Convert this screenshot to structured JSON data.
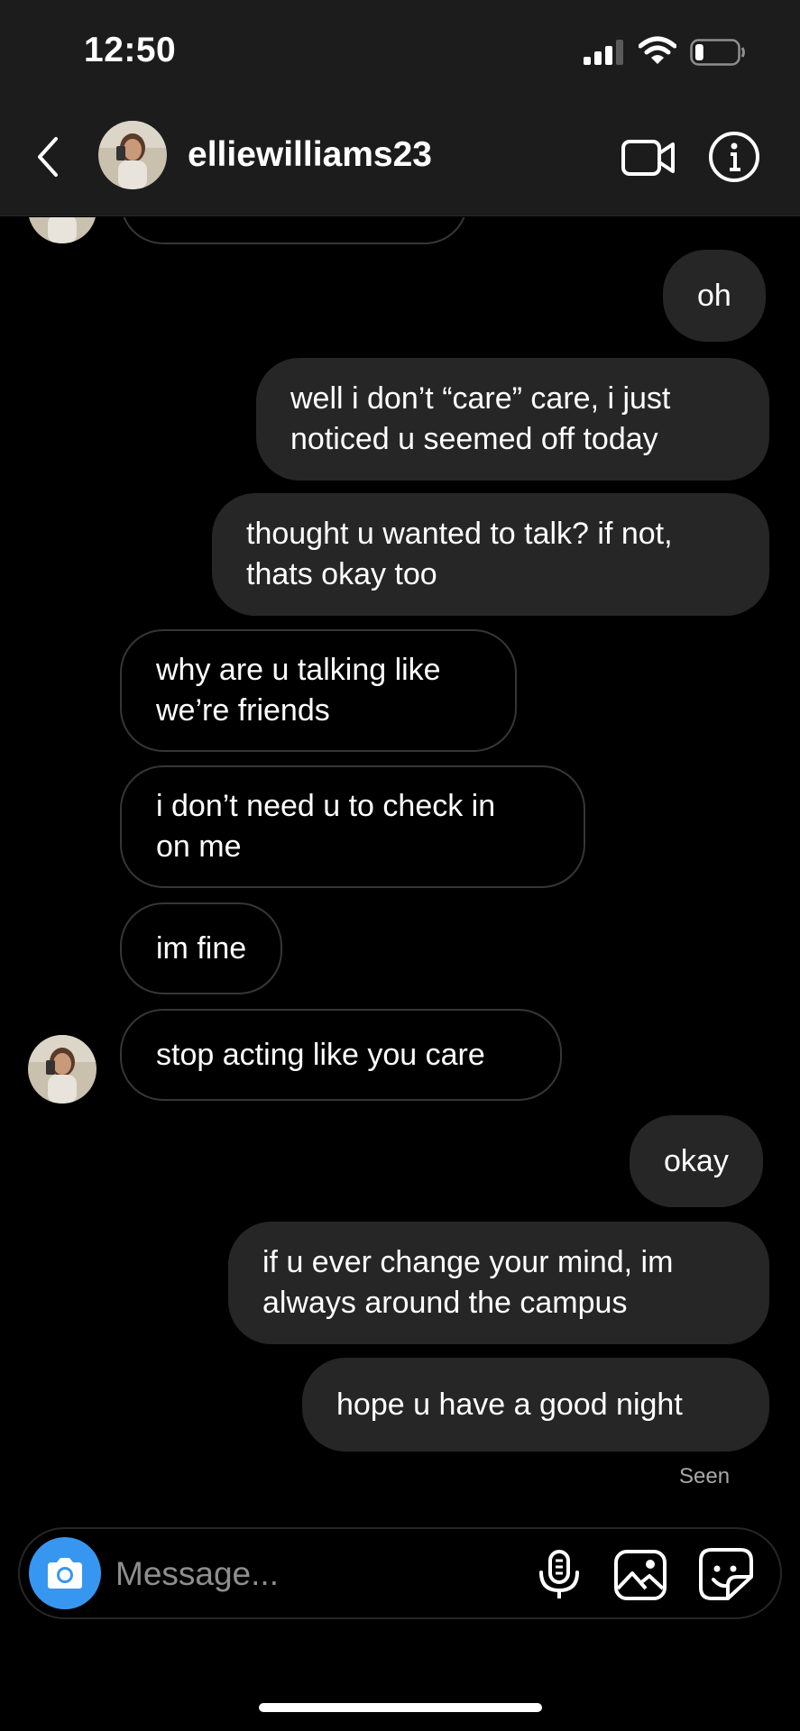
{
  "status_bar": {
    "time": "12:50",
    "icons": [
      "cellular-signal-icon",
      "wifi-icon",
      "battery-icon"
    ],
    "battery_level": 0.2
  },
  "header": {
    "username": "elliewilliams23",
    "icons": [
      "back-chevron-icon",
      "avatar",
      "video-call-icon",
      "info-icon"
    ]
  },
  "messages": [
    {
      "direction": "outgoing",
      "text": "oh"
    },
    {
      "direction": "outgoing",
      "lines": [
        "well i don’t “care” care, i just",
        "noticed u seemed off today"
      ]
    },
    {
      "direction": "outgoing",
      "lines": [
        "thought u wanted to talk? if not,",
        "thats okay too"
      ]
    },
    {
      "direction": "incoming",
      "lines": [
        "why are u talking like",
        "we’re friends"
      ]
    },
    {
      "direction": "incoming",
      "lines": [
        "i don’t need u to check in",
        "on me"
      ]
    },
    {
      "direction": "incoming",
      "text": "im fine"
    },
    {
      "direction": "incoming",
      "text": "stop acting like you care"
    },
    {
      "direction": "outgoing",
      "text": "okay"
    },
    {
      "direction": "outgoing",
      "lines": [
        "if u ever change your mind, im",
        "always around the campus"
      ]
    },
    {
      "direction": "outgoing",
      "text": "hope u have a good night"
    }
  ],
  "seen_label": "Seen",
  "composer": {
    "placeholder": "Message...",
    "icons": [
      "camera-icon",
      "microphone-icon",
      "gallery-icon",
      "sticker-icon"
    ]
  },
  "colors": {
    "background": "#000000",
    "header_bg": "#1c1c1c",
    "outgoing_bubble": "#262626",
    "incoming_border": "#363636",
    "camera_button": "#3797f0",
    "muted_text": "#a8a8a8"
  }
}
